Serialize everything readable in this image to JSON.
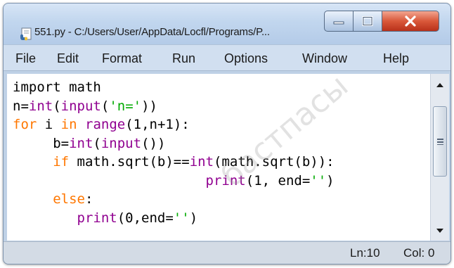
{
  "window": {
    "title": "551.py - C:/Users/User/AppData/Locfl/Programs/P..."
  },
  "title_buttons": {
    "minimize_icon": "minimize-icon",
    "maximize_icon": "maximize-icon",
    "close_icon": "close-icon",
    "close_color": "#d9583a"
  },
  "menu": {
    "items": [
      "File",
      "Edit",
      "Format",
      "Run",
      "Options",
      "Window",
      "Help"
    ]
  },
  "editor": {
    "lines": [
      [
        {
          "t": "import math",
          "c": "plain"
        }
      ],
      [
        {
          "t": "n=",
          "c": "plain"
        },
        {
          "t": "int",
          "c": "builtin"
        },
        {
          "t": "(",
          "c": "plain"
        },
        {
          "t": "input",
          "c": "builtin"
        },
        {
          "t": "(",
          "c": "plain"
        },
        {
          "t": "'n='",
          "c": "string"
        },
        {
          "t": "))",
          "c": "plain"
        }
      ],
      [
        {
          "t": "for",
          "c": "keyword"
        },
        {
          "t": " i ",
          "c": "plain"
        },
        {
          "t": "in",
          "c": "keyword"
        },
        {
          "t": " ",
          "c": "plain"
        },
        {
          "t": "range",
          "c": "builtin"
        },
        {
          "t": "(1,n+1):",
          "c": "plain"
        }
      ],
      [
        {
          "t": "     b=",
          "c": "plain"
        },
        {
          "t": "int",
          "c": "builtin"
        },
        {
          "t": "(",
          "c": "plain"
        },
        {
          "t": "input",
          "c": "builtin"
        },
        {
          "t": "())",
          "c": "plain"
        }
      ],
      [
        {
          "t": "     ",
          "c": "plain"
        },
        {
          "t": "if",
          "c": "keyword"
        },
        {
          "t": " math.sqrt(b)==",
          "c": "plain"
        },
        {
          "t": "int",
          "c": "builtin"
        },
        {
          "t": "(math.sqrt(b)):",
          "c": "plain"
        }
      ],
      [
        {
          "t": "                        ",
          "c": "plain"
        },
        {
          "t": "print",
          "c": "builtin"
        },
        {
          "t": "(1, end=",
          "c": "plain"
        },
        {
          "t": "''",
          "c": "string"
        },
        {
          "t": ")",
          "c": "plain"
        }
      ],
      [
        {
          "t": "     ",
          "c": "plain"
        },
        {
          "t": "else",
          "c": "keyword"
        },
        {
          "t": ":",
          "c": "plain"
        }
      ],
      [
        {
          "t": "        ",
          "c": "plain"
        },
        {
          "t": "print",
          "c": "builtin"
        },
        {
          "t": "(0,end=",
          "c": "plain"
        },
        {
          "t": "''",
          "c": "string"
        },
        {
          "t": ")",
          "c": "plain"
        }
      ]
    ],
    "syntax_colors": {
      "keyword": "#ff7700",
      "builtin": "#900090",
      "string": "#00aa00",
      "plain": "#000000"
    }
  },
  "scrollbar": {
    "up_icon": "scroll-up-arrow-icon",
    "down_icon": "scroll-down-arrow-icon",
    "thumb_icon": "grip-icon"
  },
  "status": {
    "line": "Ln:10",
    "col": "Col: 0"
  },
  "watermark": {
    "text": "Баспа басылымы",
    "visible_text": "бастпасы"
  }
}
